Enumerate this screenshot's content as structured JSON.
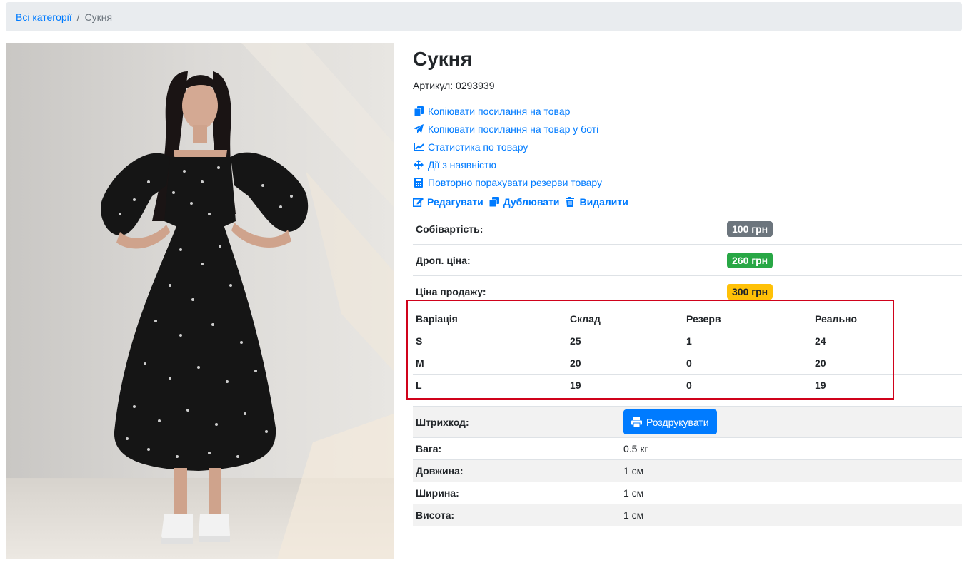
{
  "breadcrumb": {
    "root": "Всі категорії",
    "separator": "/",
    "current": "Сукня"
  },
  "product": {
    "title": "Сукня",
    "sku": "Артикул: 0293939",
    "actions": [
      {
        "label": "Копіювати посилання на товар",
        "icon": "copy-icon"
      },
      {
        "label": "Копіювати посилання на товар у боті",
        "icon": "telegram-plane-icon"
      },
      {
        "label": "Статистика по товару",
        "icon": "chart-line-icon"
      },
      {
        "label": "Дії з наявністю",
        "icon": "arrows-icon"
      },
      {
        "label": "Повторно порахувати резерви товару",
        "icon": "calculator-icon"
      }
    ],
    "edit_label": "Редагувати",
    "duplicate_label": "Дублювати",
    "delete_label": "Видалити"
  },
  "prices": [
    {
      "label": "Собівартість:",
      "value": "100 грн",
      "color": "#6c757d"
    },
    {
      "label": "Дроп. ціна:",
      "value": "260 грн",
      "color": "#28a745"
    },
    {
      "label": "Ціна продажу:",
      "value": "300 грн",
      "color": "#ffc107"
    }
  ],
  "variations": {
    "headers": [
      "Варіація",
      "Склад",
      "Резерв",
      "Реально"
    ],
    "rows": [
      [
        "S",
        "25",
        "1",
        "24"
      ],
      [
        "M",
        "20",
        "0",
        "20"
      ],
      [
        "L",
        "19",
        "0",
        "19"
      ]
    ]
  },
  "specs": {
    "barcode_label": "Штрихкод:",
    "print_label": "Роздрукувати",
    "rows": [
      {
        "label": "Вага:",
        "value": "0.5 кг"
      },
      {
        "label": "Довжина:",
        "value": "1 см"
      },
      {
        "label": "Ширина:",
        "value": "1 см"
      },
      {
        "label": "Висота:",
        "value": "1 см"
      }
    ]
  },
  "colors": {
    "link": "#007bff",
    "highlight_box": "#d0021b"
  }
}
